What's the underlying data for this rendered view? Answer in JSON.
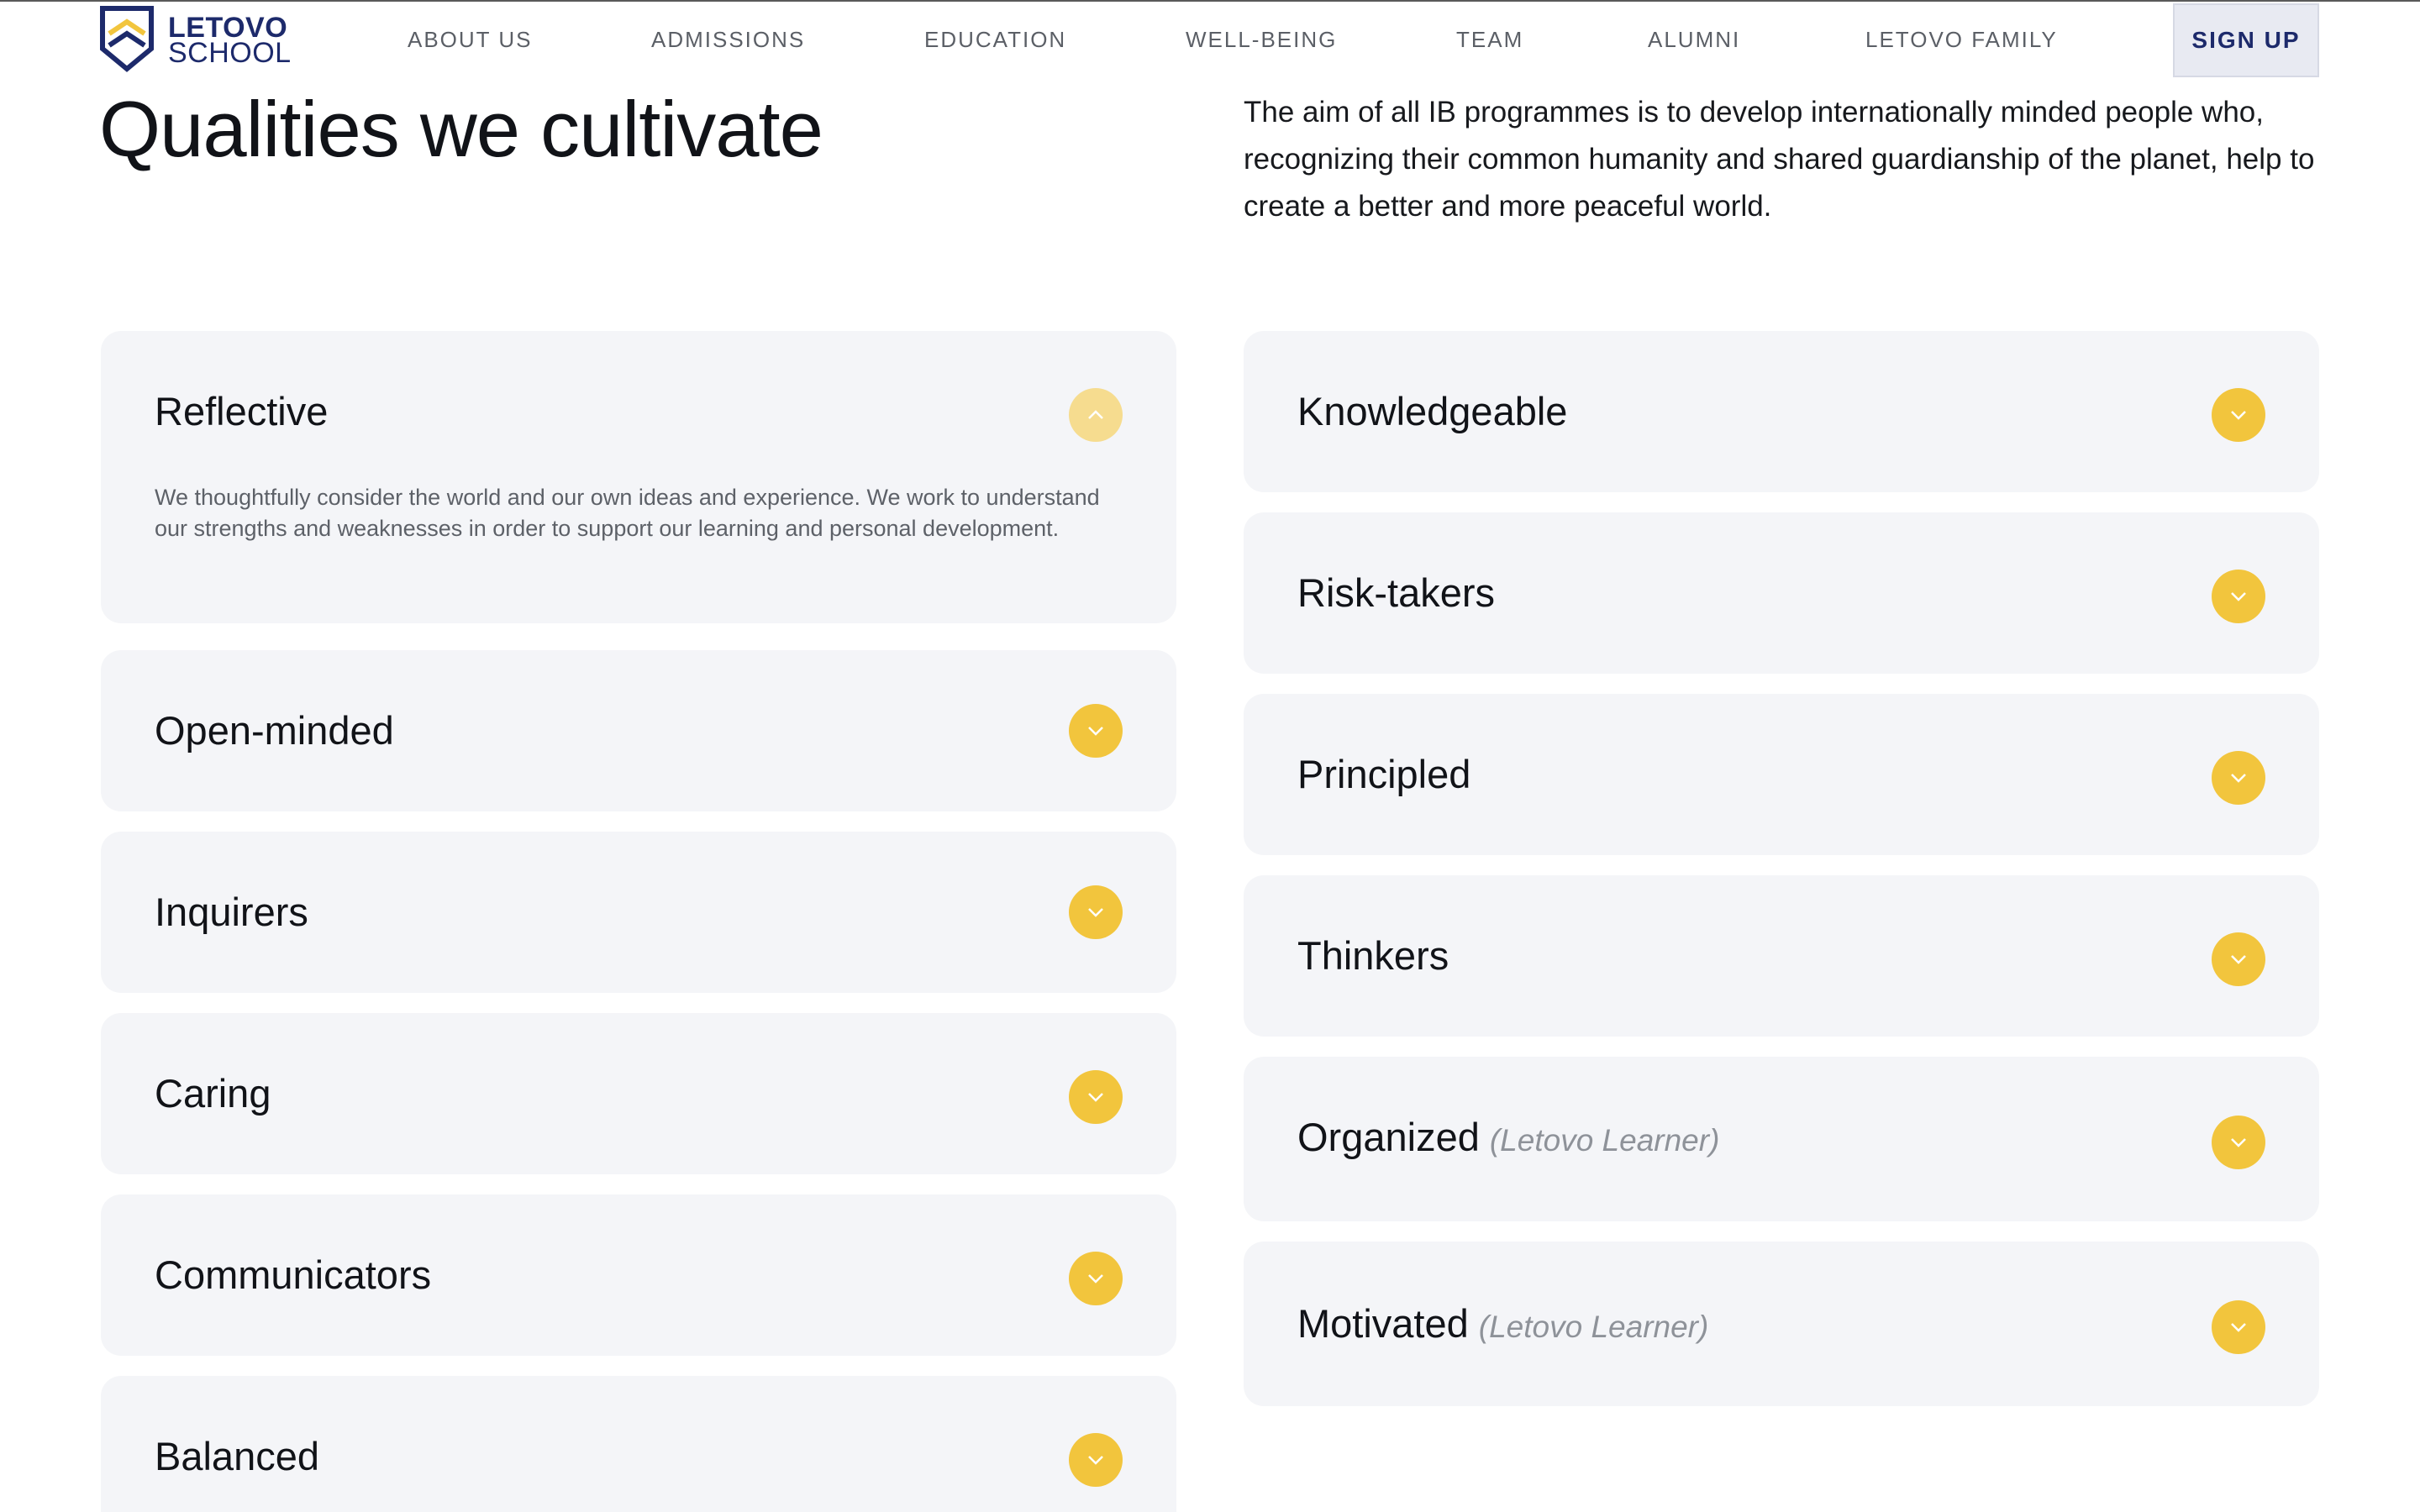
{
  "brand": {
    "name_line1": "LETOVO",
    "name_line2": "SCHOOL",
    "logo_icon": "letovo-shield-logo",
    "color": "#1d2a6b"
  },
  "nav": {
    "items": [
      {
        "label": "ABOUT US"
      },
      {
        "label": "ADMISSIONS"
      },
      {
        "label": "EDUCATION"
      },
      {
        "label": "WELL-BEING"
      },
      {
        "label": "TEAM"
      },
      {
        "label": "ALUMNI"
      },
      {
        "label": "LETOVO FAMILY"
      }
    ],
    "signup_label": "SIGN UP"
  },
  "section": {
    "title": "Qualities we cultivate",
    "intro": "The aim of all IB programmes is to develop internationally minded people who, recognizing their common humanity and shared guardianship of the planet, help to create a better and more peaceful world."
  },
  "accordion": {
    "left": [
      {
        "title": "Reflective",
        "subtitle": "",
        "expanded": true,
        "body": "We thoughtfully consider the world and our own ideas and experience. We work to understand our strengths and weaknesses in order to support our learning and personal development."
      },
      {
        "title": "Open-minded",
        "subtitle": "",
        "expanded": false
      },
      {
        "title": "Inquirers",
        "subtitle": "",
        "expanded": false
      },
      {
        "title": "Caring",
        "subtitle": "",
        "expanded": false
      },
      {
        "title": "Communicators",
        "subtitle": "",
        "expanded": false
      },
      {
        "title": "Balanced",
        "subtitle": "",
        "expanded": false
      }
    ],
    "right": [
      {
        "title": "Knowledgeable",
        "subtitle": "",
        "expanded": false
      },
      {
        "title": "Risk-takers",
        "subtitle": "",
        "expanded": false
      },
      {
        "title": "Principled",
        "subtitle": "",
        "expanded": false
      },
      {
        "title": "Thinkers",
        "subtitle": "",
        "expanded": false
      },
      {
        "title": "Organized",
        "subtitle": "(Letovo Learner)",
        "expanded": false
      },
      {
        "title": "Motivated",
        "subtitle": "(Letovo Learner)",
        "expanded": false
      }
    ],
    "icons": {
      "collapsed": "chevron-down-icon",
      "expanded": "chevron-up-icon"
    }
  },
  "colors": {
    "accent": "#f2c53d",
    "accent_open": "#f6dc8f",
    "card_bg": "#f4f5f8",
    "brand": "#1d2a6b"
  }
}
